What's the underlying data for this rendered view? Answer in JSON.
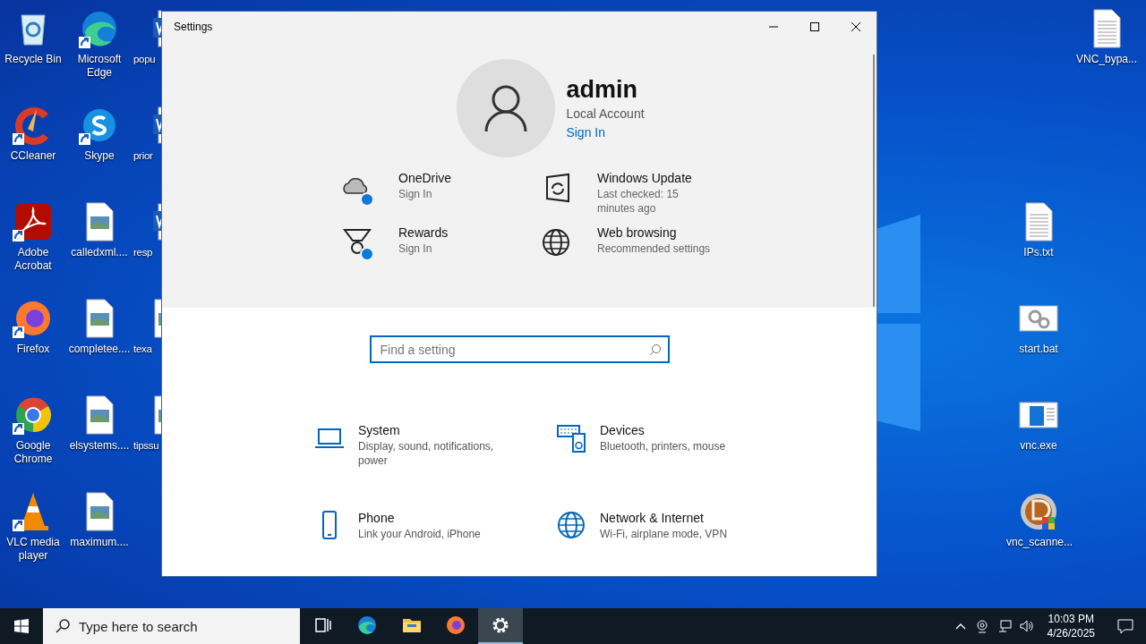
{
  "desktop": {
    "icon_columns": [
      [
        {
          "label": "Recycle Bin",
          "kind": "recycle",
          "shortcut": false
        },
        {
          "label": "CCleaner",
          "kind": "ccleaner",
          "shortcut": true
        },
        {
          "label": "Adobe Acrobat",
          "kind": "acrobat",
          "shortcut": true
        },
        {
          "label": "Firefox",
          "kind": "firefox",
          "shortcut": true
        },
        {
          "label": "Google Chrome",
          "kind": "chrome",
          "shortcut": true
        },
        {
          "label": "VLC media player",
          "kind": "vlc",
          "shortcut": true
        }
      ],
      [
        {
          "label": "Microsoft Edge",
          "kind": "edge",
          "shortcut": true
        },
        {
          "label": "Skype",
          "kind": "skype",
          "shortcut": true
        },
        {
          "label": "calledxml....",
          "kind": "image",
          "shortcut": false
        },
        {
          "label": "completee....",
          "kind": "image",
          "shortcut": false
        },
        {
          "label": "elsystems....",
          "kind": "image",
          "shortcut": false
        },
        {
          "label": "maximum....",
          "kind": "image",
          "shortcut": false
        }
      ],
      [
        {
          "label": "popu",
          "kind": "word",
          "shortcut": false
        },
        {
          "label": "prior",
          "kind": "word",
          "shortcut": false
        },
        {
          "label": "resp",
          "kind": "word",
          "shortcut": false
        },
        {
          "label": "texa",
          "kind": "image",
          "shortcut": false
        },
        {
          "label": "tipssu",
          "kind": "image",
          "shortcut": false
        }
      ]
    ],
    "right_icons": [
      {
        "label": "VNC_bypa...",
        "kind": "text",
        "shortcut": false
      },
      {
        "label": "IPs.txt",
        "kind": "text",
        "shortcut": false
      },
      {
        "label": "start.bat",
        "kind": "bat",
        "shortcut": false
      },
      {
        "label": "vnc.exe",
        "kind": "exe",
        "shortcut": false
      },
      {
        "label": "vnc_scanne...",
        "kind": "scanner",
        "shortcut": false
      }
    ]
  },
  "window": {
    "title": "Settings",
    "account": {
      "name": "admin",
      "type": "Local Account",
      "link": "Sign In"
    },
    "quick_links": [
      {
        "title": "OneDrive",
        "subtitle": "Sign In",
        "kind": "cloud",
        "badge": true
      },
      {
        "title": "Windows Update",
        "subtitle": "Last checked: 15 minutes ago",
        "kind": "update",
        "badge": false
      },
      {
        "title": "Rewards",
        "subtitle": "Sign In",
        "kind": "medal",
        "badge": true
      },
      {
        "title": "Web browsing",
        "subtitle": "Recommended settings",
        "kind": "globe",
        "badge": false
      }
    ],
    "search": {
      "placeholder": "Find a setting"
    },
    "categories": [
      {
        "title": "System",
        "description": "Display, sound, notifications, power",
        "kind": "laptop"
      },
      {
        "title": "Devices",
        "description": "Bluetooth, printers, mouse",
        "kind": "devices"
      },
      {
        "title": "Phone",
        "description": "Link your Android, iPhone",
        "kind": "phone"
      },
      {
        "title": "Network & Internet",
        "description": "Wi-Fi, airplane mode, VPN",
        "kind": "globe"
      }
    ]
  },
  "taskbar": {
    "search": {
      "placeholder": "Type here to search"
    },
    "apps": [
      {
        "kind": "taskview",
        "selected": false
      },
      {
        "kind": "edge",
        "selected": false
      },
      {
        "kind": "folder",
        "selected": false
      },
      {
        "kind": "firefox",
        "selected": false
      },
      {
        "kind": "gear",
        "selected": true
      }
    ],
    "clock": {
      "time": "10:03 PM",
      "date": "4/26/2025"
    }
  }
}
